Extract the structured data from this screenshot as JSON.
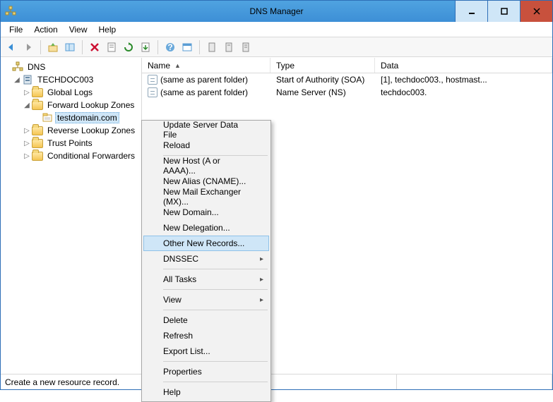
{
  "title": "DNS Manager",
  "menubar": [
    "File",
    "Action",
    "View",
    "Help"
  ],
  "tree": {
    "root": "DNS",
    "server": "TECHDOC003",
    "nodes": {
      "global_logs": "Global Logs",
      "fwd_zones": "Forward Lookup Zones",
      "zone_selected": "testdomain.com",
      "rev_zones": "Reverse Lookup Zones",
      "trust_points": "Trust Points",
      "cond_fwd": "Conditional Forwarders"
    }
  },
  "list": {
    "headers": {
      "name": "Name",
      "type": "Type",
      "data": "Data"
    },
    "rows": [
      {
        "name": "(same as parent folder)",
        "type": "Start of Authority (SOA)",
        "data": "[1], techdoc003., hostmast..."
      },
      {
        "name": "(same as parent folder)",
        "type": "Name Server (NS)",
        "data": "techdoc003."
      }
    ]
  },
  "context_menu": {
    "items": [
      {
        "label": "Update Server Data File"
      },
      {
        "label": "Reload"
      },
      {
        "sep": true
      },
      {
        "label": "New Host (A or AAAA)..."
      },
      {
        "label": "New Alias (CNAME)..."
      },
      {
        "label": "New Mail Exchanger (MX)..."
      },
      {
        "label": "New Domain..."
      },
      {
        "label": "New Delegation..."
      },
      {
        "label": "Other New Records...",
        "hover": true
      },
      {
        "label": "DNSSEC",
        "sub": true
      },
      {
        "sep": true
      },
      {
        "label": "All Tasks",
        "sub": true
      },
      {
        "sep": true
      },
      {
        "label": "View",
        "sub": true
      },
      {
        "sep": true
      },
      {
        "label": "Delete"
      },
      {
        "label": "Refresh"
      },
      {
        "label": "Export List..."
      },
      {
        "sep": true
      },
      {
        "label": "Properties"
      },
      {
        "sep": true
      },
      {
        "label": "Help"
      }
    ]
  },
  "status": "Create a new resource record."
}
